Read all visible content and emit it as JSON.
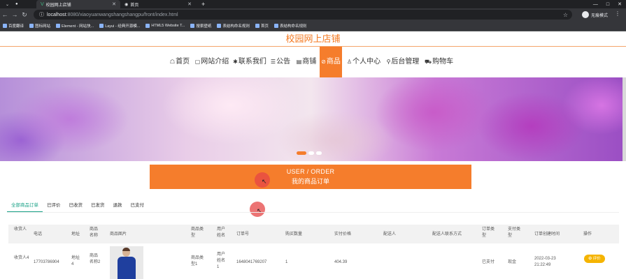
{
  "browser": {
    "tabs": [
      {
        "title": "校园网上店铺",
        "active": true
      },
      {
        "title": "首页",
        "active": false
      }
    ],
    "new_tab": "+",
    "url_host": "localhost",
    "url_rest": ":8080/xiaoyuanwangshangshangpu/front/index.html",
    "profile_label": "无痕模式",
    "window_controls": [
      "—",
      "□",
      "✕"
    ],
    "bookmarks": [
      "百度翻译",
      "图标网站",
      "Element - 网站快...",
      "Layui - 经典开源模...",
      "HTML5 Website T...",
      "搜索壁纸",
      "表结构命名规则",
      "首页",
      "表结构命名规则"
    ]
  },
  "site": {
    "title": "校园网上店铺",
    "accent": "#f57d2c",
    "nav": [
      {
        "icon": "☖",
        "label": "首页"
      },
      {
        "icon": "▢",
        "label": "网站介绍"
      },
      {
        "icon": "✱",
        "label": "联系我们"
      },
      {
        "icon": "☰",
        "label": "公告"
      },
      {
        "icon": "▤",
        "label": "商铺"
      },
      {
        "icon": "⊘",
        "label": "商品",
        "active": true
      },
      {
        "icon": "♙",
        "label": "个人中心"
      },
      {
        "icon": "⚲",
        "label": "后台管理"
      },
      {
        "icon": "⛟",
        "label": "购物车"
      }
    ]
  },
  "banner": {
    "active_slide": 1,
    "slide_count": 3
  },
  "order_panel": {
    "line1": "USER / ORDER",
    "line2": "我的商品订单"
  },
  "order_tabs": [
    "全部商品订单",
    "已评价",
    "已收货",
    "已发货",
    "退款",
    "已支付"
  ],
  "table": {
    "headers": [
      "收货人",
      "电话",
      "地址",
      "商品名称",
      "商品图片",
      "商品类型",
      "用户姓名",
      "订单号",
      "购买数量",
      "实付价格",
      "配送人",
      "配送人联系方式",
      "订单类型",
      "支付类型",
      "订单创建时间",
      "操作"
    ],
    "rows": [
      {
        "receiver": "收货人4",
        "phone": "17703786904",
        "address": "地址4",
        "product_name": "商品名称2",
        "product_type": "商品类型1",
        "user_name": "用户姓名1",
        "order_no": "1648041769207",
        "quantity": "1",
        "price": "404.39",
        "courier": "",
        "courier_phone": "",
        "order_type": "已支付",
        "pay_type": "现金",
        "created": "2022-03-23 21:22:49",
        "action": "评价"
      }
    ]
  }
}
